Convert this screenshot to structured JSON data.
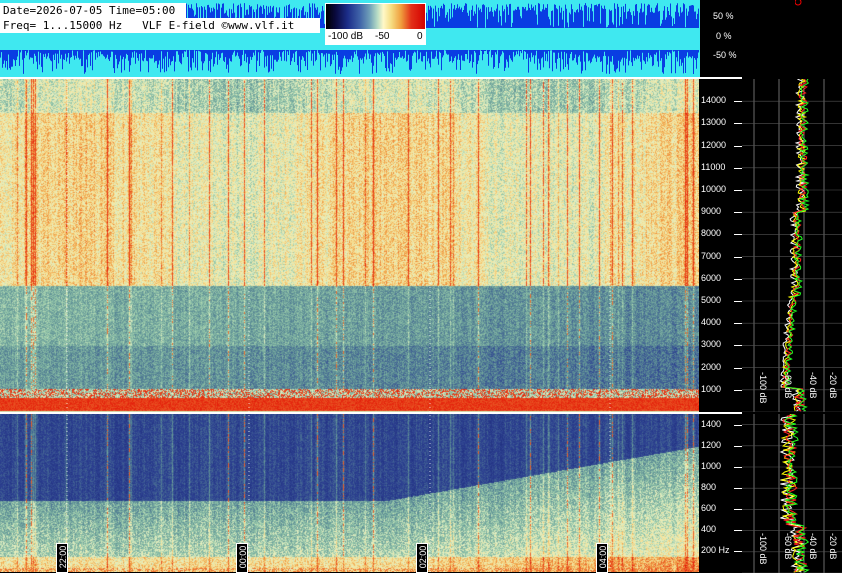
{
  "header": {
    "line1": "Date=2026-07-05 Time=05:00",
    "line2": "Freq= 1...15000 Hz   VLF E-field ©www.vlf.it"
  },
  "colorbar": {
    "labels": [
      "-100 dB",
      "-50",
      "0"
    ]
  },
  "chart_data": [
    {
      "type": "area",
      "name": "amplitude-strip",
      "y_ticks": [
        "50 %",
        "0 %",
        "-50 %"
      ],
      "colors": {
        "background": "#3fe8f0",
        "trace": "#0020e0"
      }
    },
    {
      "type": "heatmap",
      "name": "wideband-spectrogram",
      "freq_range_hz": [
        1,
        15000
      ],
      "y_ticks": [
        "14000",
        "13000",
        "12000",
        "11000",
        "10000",
        "9000",
        "8000",
        "7000",
        "6000",
        "5000",
        "4000",
        "3000",
        "2000",
        "1000"
      ],
      "colors": {
        "low": "#2a3e8e",
        "mid": "#8fc0a2",
        "high": "#f6e49a",
        "max": "#e41a0a"
      }
    },
    {
      "type": "heatmap",
      "name": "lowfreq-spectrogram",
      "y_ticks": [
        "1400",
        "1200",
        "1000",
        "800",
        "600",
        "400",
        "200 Hz"
      ],
      "time_labels": [
        "22:00",
        "00:00",
        "02:00",
        "04:00"
      ]
    },
    {
      "type": "line",
      "name": "spectrum-profile-upper",
      "x_ticks": [
        "-100 dB",
        "-60 dB",
        "-40 dB",
        "-20 dB"
      ],
      "series_colors": [
        "#ffffff",
        "#ffff00",
        "#ff2020",
        "#20ff20"
      ]
    },
    {
      "type": "line",
      "name": "spectrum-profile-lower",
      "x_ticks": [
        "-100 dB",
        "-60 dB",
        "-40 dB",
        "-20 dB"
      ]
    }
  ]
}
